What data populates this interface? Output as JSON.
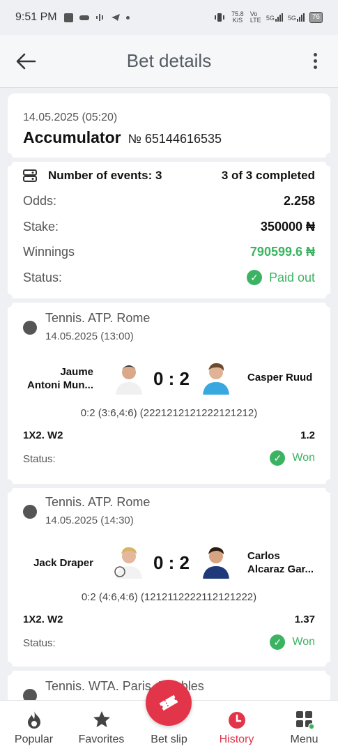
{
  "status_bar": {
    "time": "9:51 PM",
    "network_speed": "75.8 K/S",
    "volte": "Vo LTE",
    "sig1": "5G",
    "sig2": "5G",
    "battery": "76"
  },
  "header": {
    "title": "Bet details"
  },
  "bet": {
    "date": "14.05.2025 (05:20)",
    "type": "Accumulator",
    "number": "№ 65144616535",
    "events_label": "Number of events: 3",
    "completed": "3 of 3 completed",
    "odds_label": "Odds:",
    "odds": "2.258",
    "stake_label": "Stake:",
    "stake": "350000 ₦",
    "winnings_label": "Winnings",
    "winnings": "790599.6 ₦",
    "status_label": "Status:",
    "status": "Paid out"
  },
  "events": [
    {
      "league": "Tennis. ATP. Rome",
      "date": "14.05.2025 (13:00)",
      "team1_line1": "Jaume",
      "team1_line2": "Antoni Mun...",
      "team2_line1": "Casper Ruud",
      "team2_line2": "",
      "score": "0 : 2",
      "detail": "0:2 (3:6,4:6) (2221212121222121212)",
      "market": "1X2. W2",
      "odds": "1.2",
      "status_label": "Status:",
      "status": "Won"
    },
    {
      "league": "Tennis. ATP. Rome",
      "date": "14.05.2025 (14:30)",
      "team1_line1": "Jack Draper",
      "team1_line2": "",
      "team2_line1": "Carlos",
      "team2_line2": "Alcaraz Gar...",
      "score": "0 : 2",
      "detail": "0:2 (4:6,4:6) (1212112222112121222)",
      "market": "1X2. W2",
      "odds": "1.37",
      "status_label": "Status:",
      "status": "Won"
    },
    {
      "league": "Tennis. WTA. Paris. Doubles"
    }
  ],
  "nav": {
    "popular": "Popular",
    "favorites": "Favorites",
    "bet_slip": "Bet slip",
    "history": "History",
    "menu": "Menu"
  },
  "colors": {
    "accent": "#e3354a",
    "success": "#3cb362"
  }
}
